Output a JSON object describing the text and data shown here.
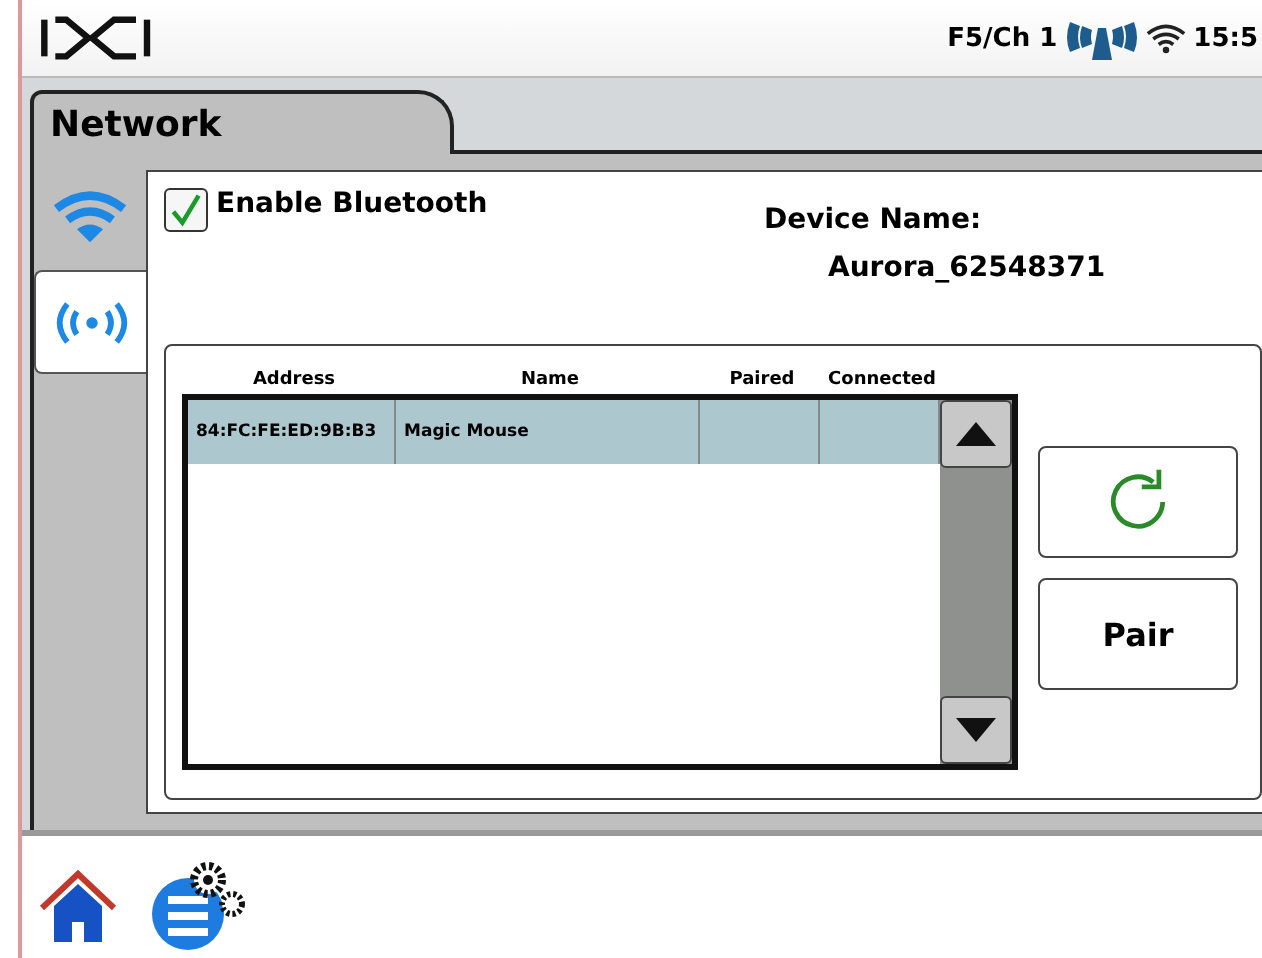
{
  "status_bar": {
    "channel": "F5/Ch 1",
    "time": "15:5"
  },
  "page": {
    "title": "Network"
  },
  "side_tabs": [
    {
      "kind": "wifi",
      "selected": false
    },
    {
      "kind": "bluetooth",
      "selected": true
    }
  ],
  "enable_bluetooth": {
    "label": "Enable Bluetooth",
    "checked": true
  },
  "device_name": {
    "label": "Device Name:",
    "value": "Aurora_62548371"
  },
  "table": {
    "columns": [
      "Address",
      "Name",
      "Paired",
      "Connected"
    ],
    "rows": [
      {
        "cells": [
          "84:FC:FE:ED:9B:B3",
          "Magic Mouse"
        ],
        "selected": true
      }
    ]
  },
  "buttons": [
    {
      "kind": "refresh"
    },
    {
      "kind": "text",
      "label": "Pair"
    }
  ]
}
